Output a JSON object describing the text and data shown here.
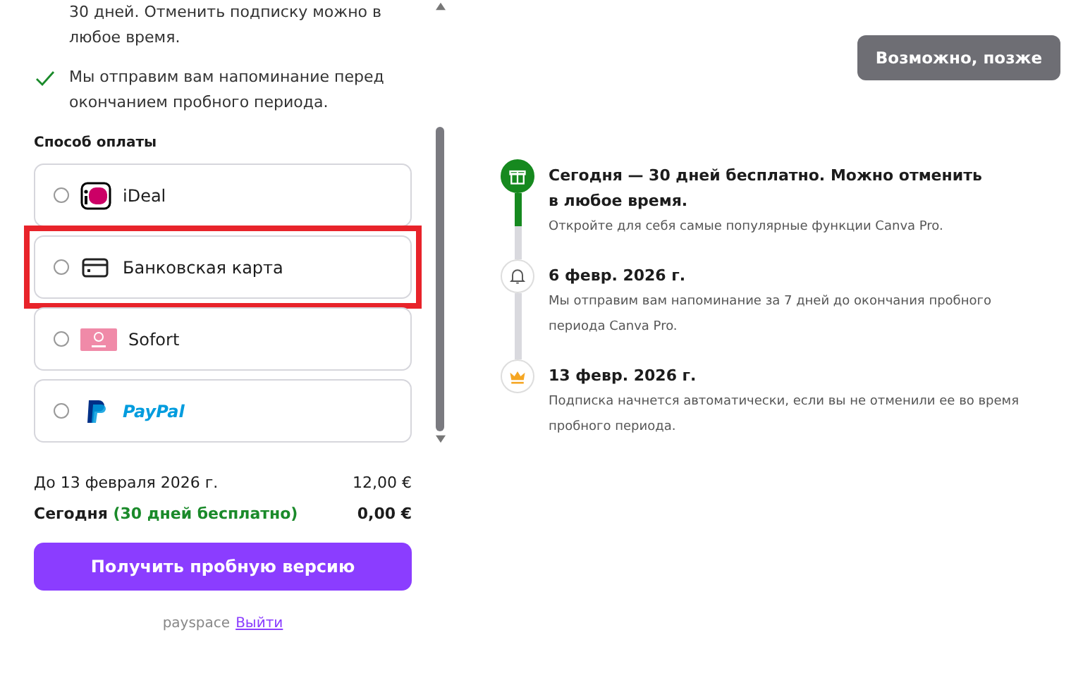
{
  "benefits": [
    {
      "text": "30 дней. Отменить подписку можно в любое время.",
      "checked": false
    },
    {
      "text": "Мы отправим вам напоминание перед окончанием пробного периода.",
      "checked": true
    }
  ],
  "payment": {
    "heading": "Способ оплаты",
    "methods": [
      {
        "kind": "ideal",
        "label": "iDeal",
        "selected": false,
        "highlighted": false
      },
      {
        "kind": "card",
        "label": "Банковская карта",
        "selected": false,
        "highlighted": true
      },
      {
        "kind": "sofort",
        "label": "Sofort",
        "selected": false,
        "highlighted": false
      },
      {
        "kind": "paypal",
        "label": "PayPal",
        "selected": false,
        "highlighted": false
      }
    ]
  },
  "summary": [
    {
      "label": "До 13 февраля 2026 г.",
      "amount": "12,00 €",
      "bold": false
    },
    {
      "label": "Сегодня",
      "note": "(30 дней бесплатно)",
      "amount": "0,00 €",
      "bold": true
    }
  ],
  "cta": "Получить пробную версию",
  "footer": {
    "account": "payspace",
    "logout": "Выйти"
  },
  "later_button": "Возможно, позже",
  "timeline": [
    {
      "kind": "gift",
      "title": "Сегодня — 30 дней бесплатно. Можно отменить в любое время.",
      "text": "Откройте для себя самые популярные функции Canva Pro.",
      "done": true
    },
    {
      "kind": "bell",
      "title": "6 февр. 2026 г.",
      "text": "Мы отправим вам напоминание за 7 дней до окончания пробного периода Canva Pro.",
      "done": false
    },
    {
      "kind": "crown",
      "title": "13 февр. 2026 г.",
      "text": "Подписка начнется автоматически, если вы не отменили ее во время пробного периода.",
      "done": false
    }
  ]
}
